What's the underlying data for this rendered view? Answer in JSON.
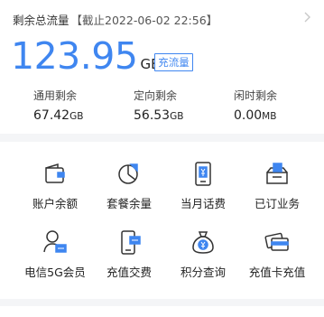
{
  "header": {
    "title": "剩余总流量",
    "deadline": "【截止2022-06-02 22:56】"
  },
  "total": {
    "value": "123.95",
    "unit": "GB",
    "recharge_label": "充流量"
  },
  "stats": [
    {
      "label": "通用剩余",
      "value": "67.42",
      "unit": "GB"
    },
    {
      "label": "定向剩余",
      "value": "56.53",
      "unit": "GB"
    },
    {
      "label": "闲时剩余",
      "value": "0.00",
      "unit": "MB"
    }
  ],
  "grid": [
    {
      "label": "账户余额",
      "icon": "wallet-icon"
    },
    {
      "label": "套餐余量",
      "icon": "pie-chart-icon"
    },
    {
      "label": "当月话费",
      "icon": "phone-bill-icon"
    },
    {
      "label": "已订业务",
      "icon": "subscribed-box-icon"
    },
    {
      "label": "电信5G会员",
      "icon": "member-card-icon"
    },
    {
      "label": "充值交费",
      "icon": "phone-recharge-icon"
    },
    {
      "label": "积分查询",
      "icon": "money-bag-icon"
    },
    {
      "label": "充值卡充值",
      "icon": "cards-icon"
    }
  ],
  "colors": {
    "accent": "#3f86f0",
    "page_bg": "#f4f5f7"
  }
}
